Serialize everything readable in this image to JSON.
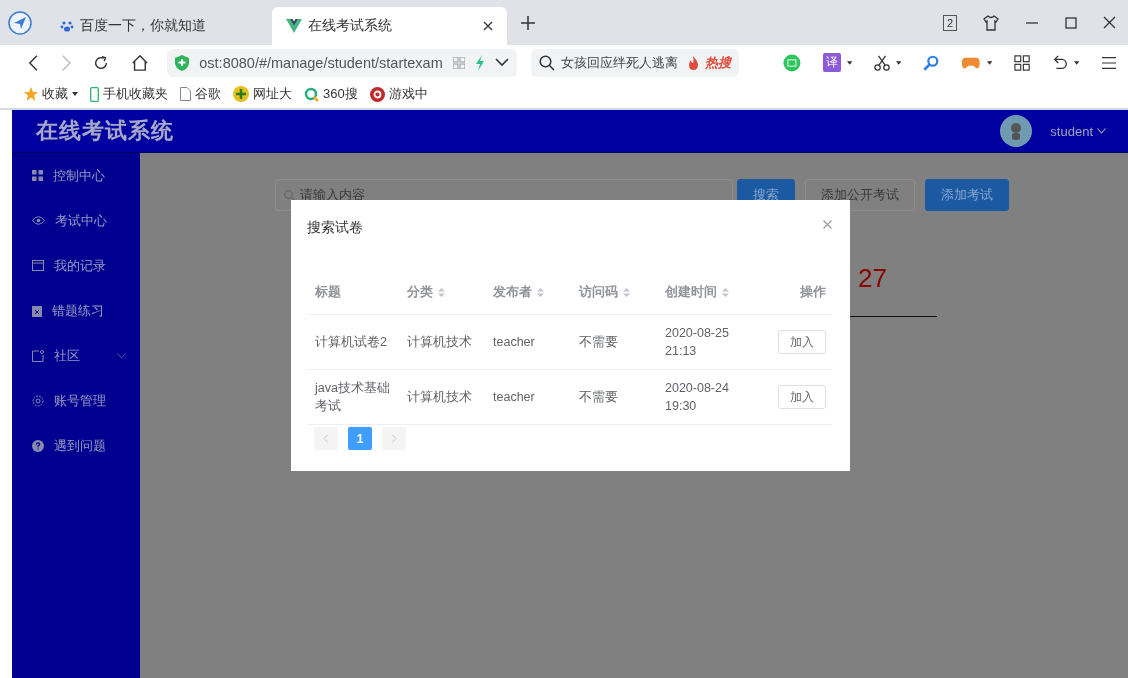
{
  "browser": {
    "tabs": [
      {
        "title": "百度一下，你就知道",
        "selected": false
      },
      {
        "title": "在线考试系统",
        "selected": true
      }
    ],
    "window_count": "2",
    "address": "ost:8080/#/manage/student/startexam",
    "search": {
      "value": "女孩回应绊死人逃离",
      "hot_label": "热搜"
    },
    "translate_label": "译",
    "bookmarks": [
      "收藏",
      "手机收藏夹",
      "谷歌",
      "网址大",
      "360搜",
      "游戏中"
    ]
  },
  "app": {
    "title": "在线考试系统",
    "user": "student",
    "sidebar": [
      {
        "label": "控制中心",
        "expandable": false
      },
      {
        "label": "考试中心",
        "expandable": false
      },
      {
        "label": "我的记录",
        "expandable": false
      },
      {
        "label": "错题练习",
        "expandable": false
      },
      {
        "label": "社区",
        "expandable": true
      },
      {
        "label": "账号管理",
        "expandable": false
      },
      {
        "label": "遇到问题",
        "expandable": false
      }
    ],
    "toolbar": {
      "placeholder": "请输入内容",
      "buttons": [
        {
          "label": "搜索",
          "kind": "primary"
        },
        {
          "label": "添加公开考试",
          "kind": "plain"
        },
        {
          "label": "添加考试",
          "kind": "primary"
        }
      ]
    },
    "background_number": "27",
    "dialog": {
      "title": "搜索试卷",
      "columns": [
        {
          "label": "标题",
          "sortable": false
        },
        {
          "label": "分类",
          "sortable": true
        },
        {
          "label": "发布者",
          "sortable": true
        },
        {
          "label": "访问码",
          "sortable": true
        },
        {
          "label": "创建时间",
          "sortable": true
        },
        {
          "label": "操作",
          "sortable": false
        }
      ],
      "rows": [
        {
          "cells": [
            "计算机试卷2",
            "计算机技术",
            "teacher",
            "不需要",
            "2020-08-25 21:13"
          ],
          "action": "加入"
        },
        {
          "cells": [
            "java技术基础考试",
            "计算机技术",
            "teacher",
            "不需要",
            "2020-08-24 19:30"
          ],
          "action": "加入"
        }
      ],
      "pages": [
        {
          "label": "1",
          "selected": true
        }
      ]
    }
  }
}
